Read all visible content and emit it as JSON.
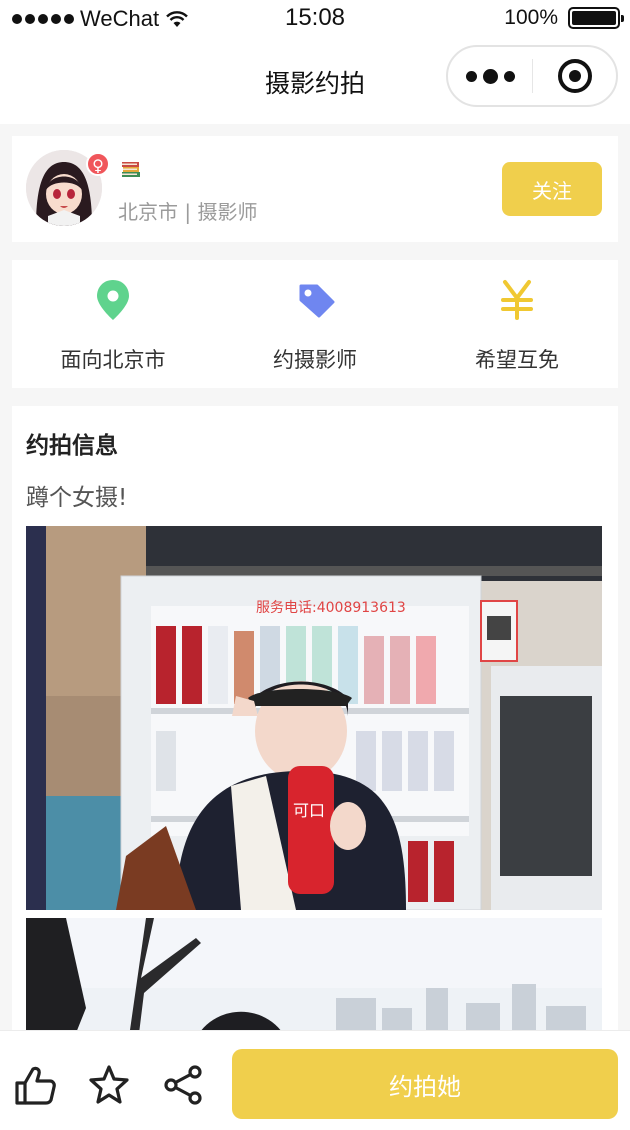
{
  "status_bar": {
    "carrier": "WeChat",
    "time": "15:08",
    "battery": "100%",
    "battery_level": 1.0
  },
  "nav": {
    "title": "摄影约拍"
  },
  "profile": {
    "location_role": "北京市 | 摄影师",
    "gender_symbol": "♀",
    "follow_label": "关注"
  },
  "features": [
    {
      "label": "面向北京市",
      "icon": "location-pin-icon",
      "color": "#5fd38d"
    },
    {
      "label": "约摄影师",
      "icon": "tag-icon",
      "color": "#6f86f0"
    },
    {
      "label": "希望互免",
      "icon": "yen-icon",
      "color": "#f0c832"
    }
  ],
  "info": {
    "title": "约拍信息",
    "text": "蹲个女摄!"
  },
  "bottom_bar": {
    "like_icon": "thumbs-up-icon",
    "star_icon": "star-icon",
    "share_icon": "share-icon",
    "book_label": "约拍她"
  },
  "colors": {
    "accent": "#f0cf4c",
    "background": "#f6f6f6",
    "gender_badge": "#f0565b"
  }
}
